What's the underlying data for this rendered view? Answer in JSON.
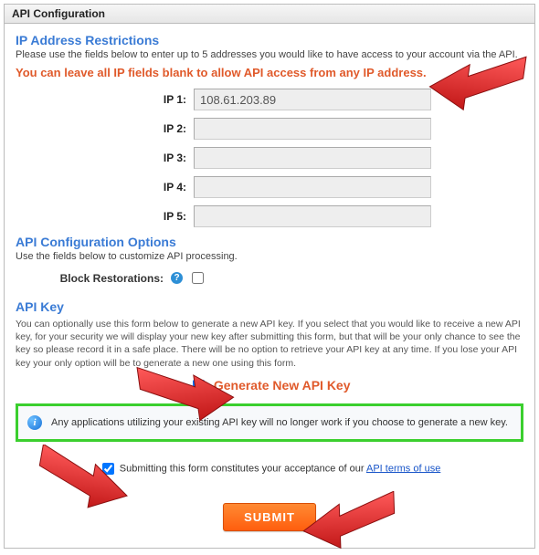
{
  "panel": {
    "title": "API Configuration"
  },
  "ipRestrictions": {
    "title": "IP Address Restrictions",
    "subtitle": "Please use the fields below to enter up to 5 addresses you would like to have access to your account via the API.",
    "warning": "You can leave all IP fields blank to allow API access from any IP address.",
    "rows": [
      {
        "label": "IP 1:",
        "value": "108.61.203.89"
      },
      {
        "label": "IP 2:",
        "value": ""
      },
      {
        "label": "IP 3:",
        "value": ""
      },
      {
        "label": "IP 4:",
        "value": ""
      },
      {
        "label": "IP 5:",
        "value": ""
      }
    ]
  },
  "options": {
    "title": "API Configuration Options",
    "subtitle": "Use the fields below to customize API processing.",
    "blockRestorations": {
      "label": "Block Restorations:",
      "checked": false
    }
  },
  "apiKey": {
    "title": "API Key",
    "paragraph": "You can optionally use this form below to generate a new API key. If you select that you would like to receive a new API key, for your security we will display your new key after submitting this form, but that will be your only chance to see the key so please record it in a safe place. There will be no option to retrieve your API key at any time. If you lose your API key your only option will be to generate a new one using this form.",
    "generate": {
      "label": "Generate New API Key",
      "checked": true
    },
    "infoBox": "Any applications utilizing your existing API key will no longer work if you choose to generate a new key."
  },
  "terms": {
    "checked": true,
    "prefix": "Submitting this form constitutes your acceptance of our ",
    "linkText": "API terms of use"
  },
  "submit": {
    "label": "SUBMIT"
  }
}
